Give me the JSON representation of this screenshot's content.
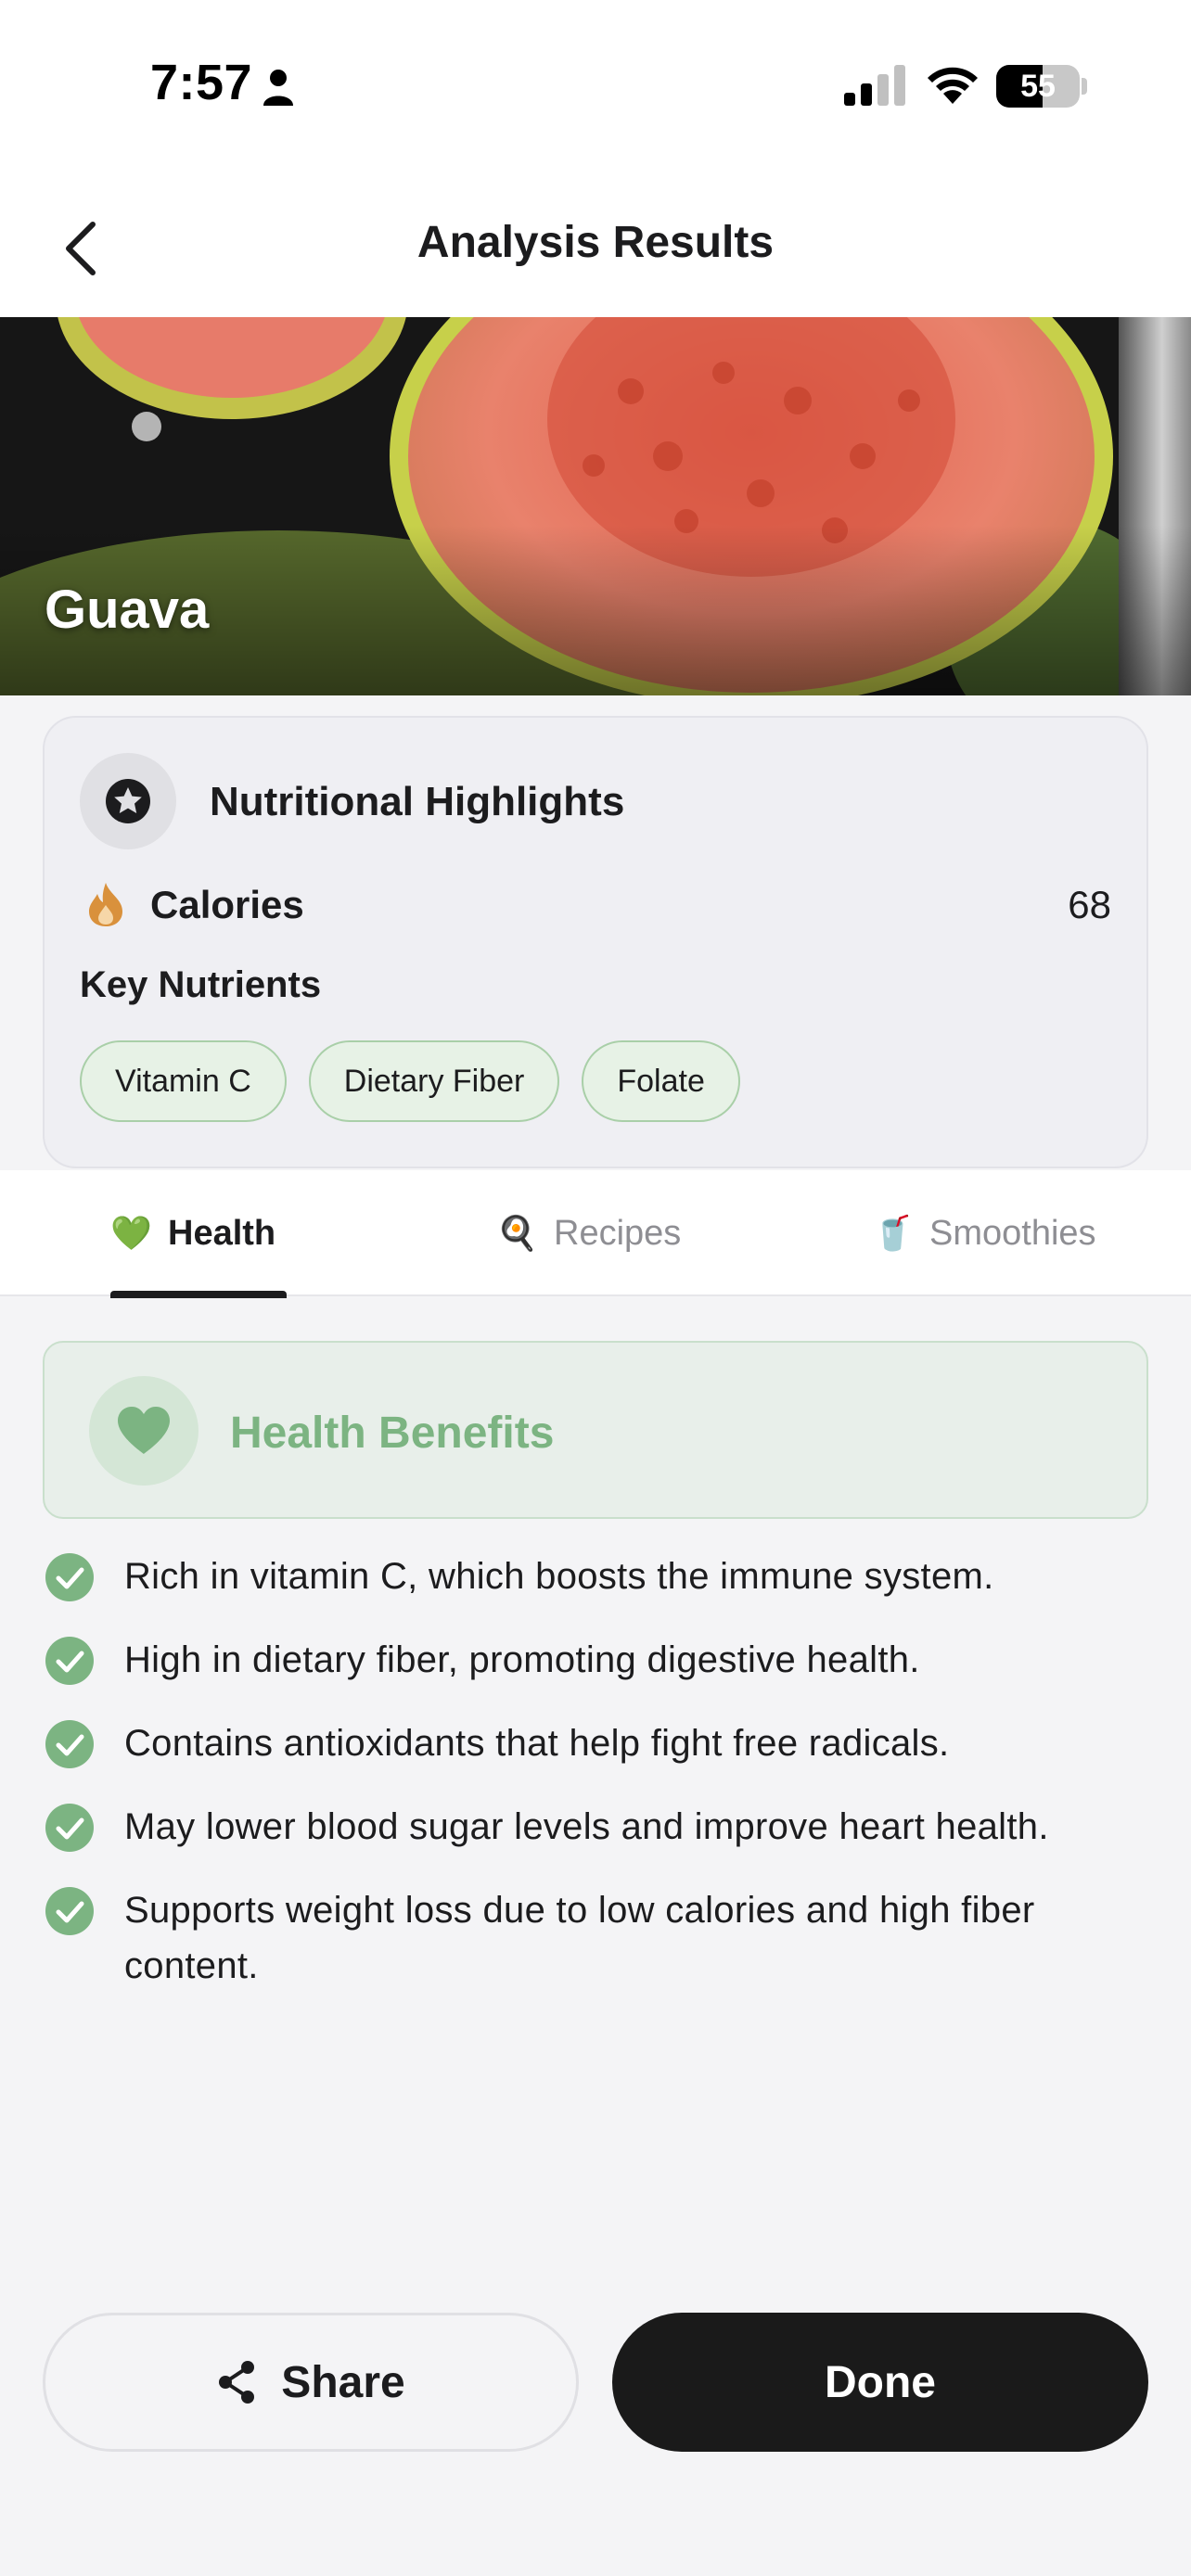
{
  "status_bar": {
    "time": "7:57",
    "battery_level": "55",
    "battery_fraction": 0.55
  },
  "nav": {
    "title": "Analysis Results",
    "back_icon": "chevron-left-icon"
  },
  "hero": {
    "food_name": "Guava"
  },
  "nutrition": {
    "title": "Nutritional Highlights",
    "badge_icon": "star-icon",
    "calories_label": "Calories",
    "calories_value": "68",
    "key_nutrients_label": "Key Nutrients",
    "nutrients": [
      "Vitamin C",
      "Dietary Fiber",
      "Folate"
    ]
  },
  "tabs": [
    {
      "label": "Health",
      "icon": "💚",
      "active": true
    },
    {
      "label": "Recipes",
      "icon": "🍳",
      "active": false
    },
    {
      "label": "Smoothies",
      "icon": "🥤",
      "active": false
    }
  ],
  "health": {
    "title": "Health Benefits",
    "accent_color": "#7cb482",
    "benefits": [
      "Rich in vitamin C, which boosts the immune system.",
      "High in dietary fiber, promoting digestive health.",
      "Contains antioxidants that help fight free radicals.",
      "May lower blood sugar levels and improve heart health.",
      "Supports weight loss due to low calories and high fiber content."
    ]
  },
  "actions": {
    "share_label": "Share",
    "done_label": "Done"
  }
}
